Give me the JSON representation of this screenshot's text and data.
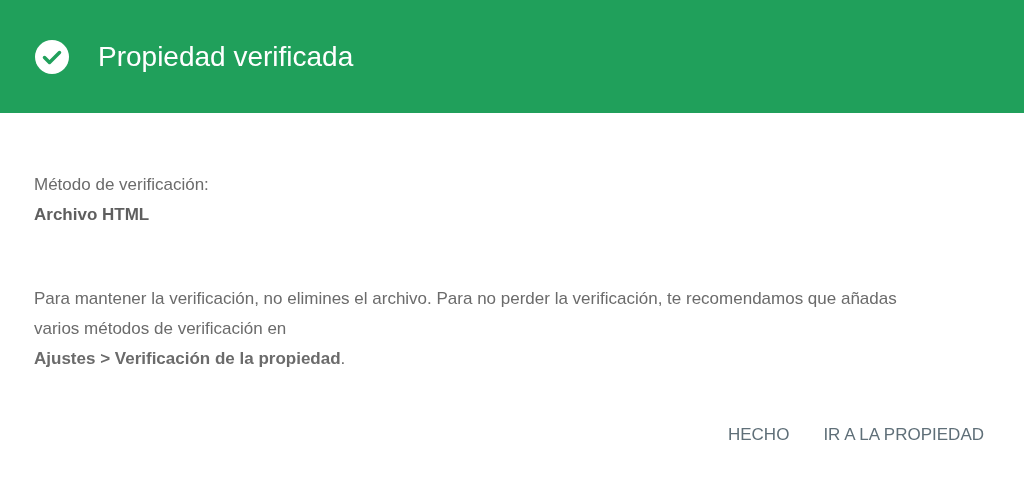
{
  "header": {
    "title": "Propiedad verificada"
  },
  "method": {
    "label": "Método de verificación:",
    "value": "Archivo HTML"
  },
  "message": "Para mantener la verificación, no elimines el archivo. Para no perder la verificación, te recomendamos que añadas varios métodos de verificación en\n**Ajustes > Verificación de la propiedad**.",
  "buttons": [
    {
      "label": "HECHO"
    },
    {
      "label": "IR A LA PROPIEDAD"
    }
  ]
}
